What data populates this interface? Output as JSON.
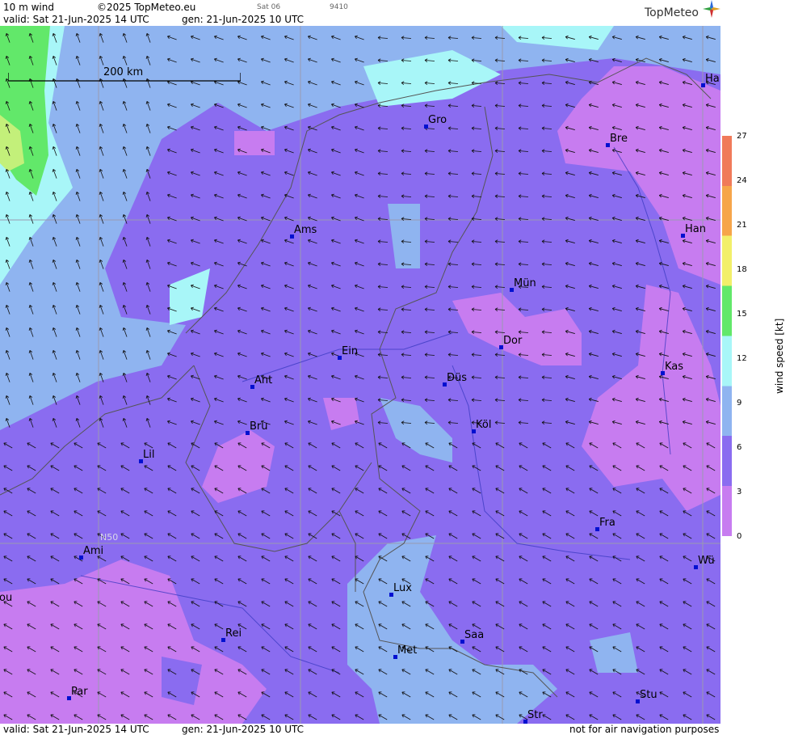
{
  "header": {
    "product": "10 m wind",
    "copyright": "©2025 TopMeteo.eu",
    "run_tag": "Sat 06",
    "code": "9410",
    "valid": "valid:  Sat  21-Jun-2025  14 UTC",
    "gen": "gen: 21-Jun-2025 10 UTC",
    "logo": "TopMeteo"
  },
  "footer": {
    "valid": "valid:  Sat  21-Jun-2025  14 UTC",
    "gen": "gen: 21-Jun-2025 10 UTC",
    "disclaimer": "not for air navigation purposes"
  },
  "scale": {
    "label": "200 km"
  },
  "grid_label": "N50",
  "legend": {
    "title": "wind  speed  [kt]",
    "ticks": [
      "27",
      "24",
      "21",
      "18",
      "15",
      "12",
      "9",
      "6",
      "3",
      "0"
    ],
    "colors": [
      "#c77cf0",
      "#8a6cf0",
      "#8fb4f0",
      "#a8f6f8",
      "#62e86a",
      "#f2ef6a",
      "#f6a54a",
      "#f07a5a"
    ]
  },
  "cities": [
    {
      "name": "Gro"
    },
    {
      "name": "Bre"
    },
    {
      "name": "Ha"
    },
    {
      "name": "Ams"
    },
    {
      "name": "Han"
    },
    {
      "name": "Mün"
    },
    {
      "name": "Dor"
    },
    {
      "name": "Ein"
    },
    {
      "name": "Kas"
    },
    {
      "name": "Ant"
    },
    {
      "name": "Düs"
    },
    {
      "name": "Köl"
    },
    {
      "name": "Bru"
    },
    {
      "name": "Lil"
    },
    {
      "name": "Fra"
    },
    {
      "name": "Ami"
    },
    {
      "name": "Wü"
    },
    {
      "name": "Lux"
    },
    {
      "name": "ou"
    },
    {
      "name": "Rei"
    },
    {
      "name": "Saa"
    },
    {
      "name": "Met"
    },
    {
      "name": "Par"
    },
    {
      "name": "Stu"
    },
    {
      "name": "Str"
    }
  ]
}
